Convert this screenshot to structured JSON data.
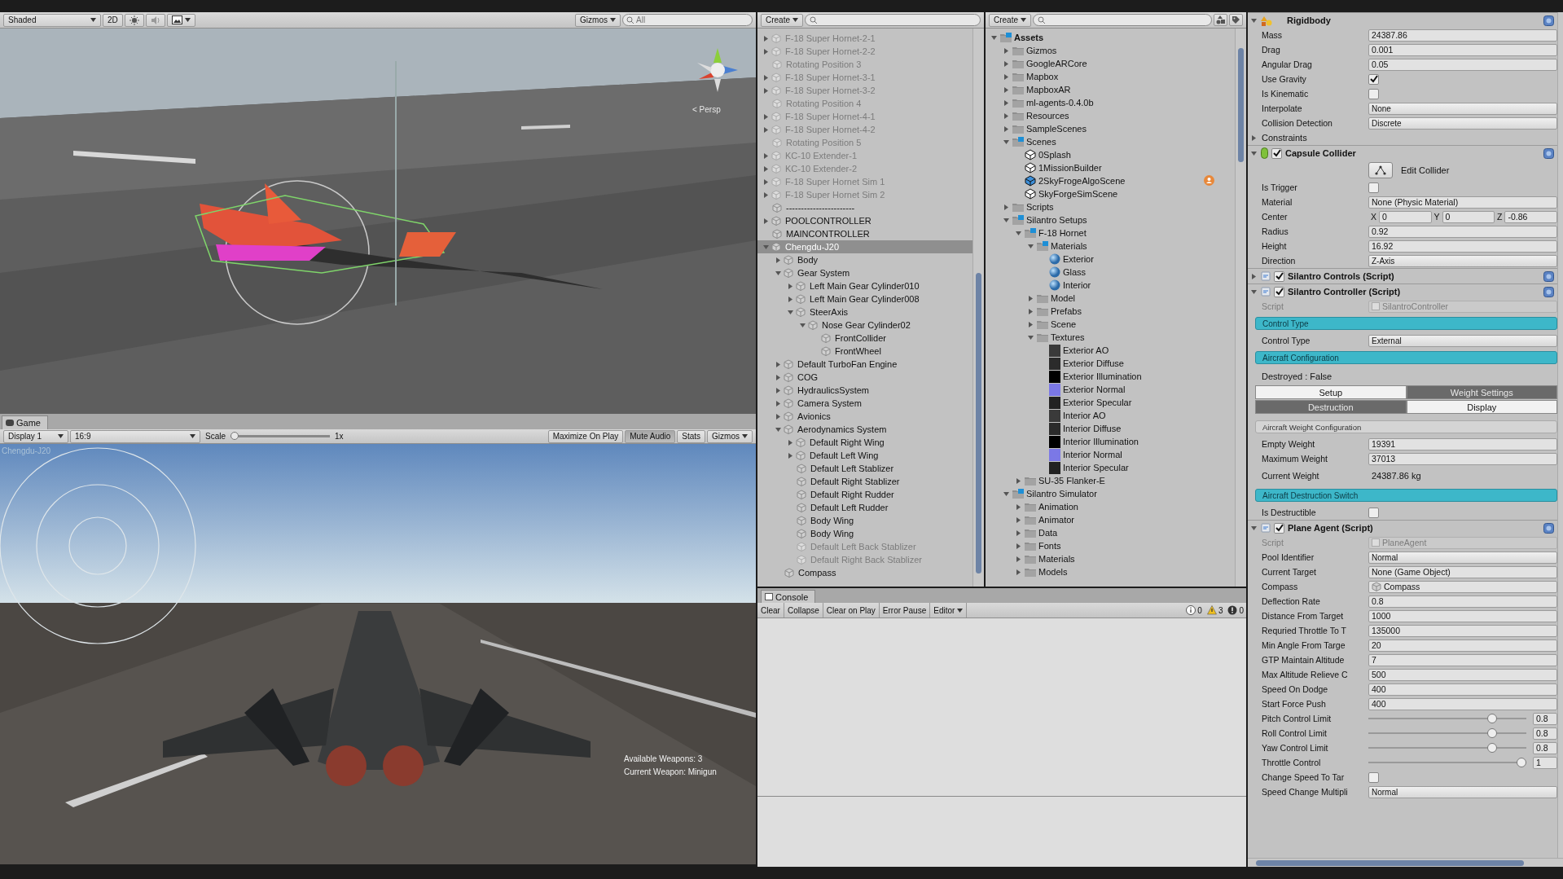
{
  "scene": {
    "toolbar": {
      "shading": "Shaded",
      "mode_2d": "2D",
      "gizmos": "Gizmos",
      "search_placeholder": "All"
    },
    "view": {
      "kind": "picture",
      "projection": "< Persp"
    }
  },
  "game": {
    "tab": "Game",
    "toolbar": {
      "display": "Display 1",
      "aspect": "16:9",
      "scale": {
        "label": "Scale",
        "level": 0,
        "value": "1x"
      },
      "buttons": [
        {
          "label": "Maximize On Play",
          "on": false
        },
        {
          "label": "Mute Audio",
          "on": true
        },
        {
          "label": "Stats",
          "on": false
        }
      ],
      "gizmos": "Gizmos"
    },
    "view": {
      "kind": "picture",
      "object_name": "Chengdu-J20",
      "weapons": "Available Weapons: 3",
      "current_weapon": "Current Weapon: Minigun"
    }
  },
  "hierarchy": {
    "create": "Create",
    "items": [
      {
        "name": "F-18 Super Hornet-2-1",
        "expanded": false,
        "active": false,
        "selected": false
      },
      {
        "name": "F-18 Super Hornet-2-2",
        "expanded": false,
        "active": false,
        "selected": false
      },
      {
        "name": "Rotating Position 3",
        "active": false,
        "selected": false
      },
      {
        "name": "F-18 Super Hornet-3-1",
        "expanded": false,
        "active": false,
        "selected": false
      },
      {
        "name": "F-18 Super Hornet-3-2",
        "expanded": false,
        "active": false,
        "selected": false
      },
      {
        "name": "Rotating Position 4",
        "active": false,
        "selected": false
      },
      {
        "name": "F-18 Super Hornet-4-1",
        "expanded": false,
        "active": false,
        "selected": false
      },
      {
        "name": "F-18 Super Hornet-4-2",
        "expanded": false,
        "active": false,
        "selected": false
      },
      {
        "name": "Rotating Position 5",
        "active": false,
        "selected": false
      },
      {
        "name": "KC-10 Extender-1",
        "expanded": false,
        "active": false,
        "selected": false
      },
      {
        "name": "KC-10 Extender-2",
        "expanded": false,
        "active": false,
        "selected": false
      },
      {
        "name": "F-18 Super Hornet Sim 1",
        "expanded": false,
        "active": false,
        "selected": false
      },
      {
        "name": "F-18 Super Hornet Sim 2",
        "expanded": false,
        "active": false,
        "selected": false
      },
      {
        "name": "-----------------------",
        "active": true,
        "selected": false
      },
      {
        "name": "POOLCONTROLLER",
        "expanded": false,
        "active": true,
        "selected": false
      },
      {
        "name": "MAINCONTROLLER",
        "active": true,
        "selected": false
      },
      {
        "name": "Chengdu-J20",
        "expanded": true,
        "active": true,
        "selected": true,
        "children": [
          {
            "name": "Body",
            "expanded": false,
            "active": true,
            "selected": false
          },
          {
            "name": "Gear System",
            "expanded": true,
            "active": true,
            "selected": false,
            "children": [
              {
                "name": "Left Main Gear Cylinder010",
                "expanded": false,
                "active": true,
                "selected": false
              },
              {
                "name": "Left Main Gear Cylinder008",
                "expanded": false,
                "active": true,
                "selected": false
              },
              {
                "name": "SteerAxis",
                "expanded": true,
                "active": true,
                "selected": false,
                "children": [
                  {
                    "name": "Nose Gear Cylinder02",
                    "expanded": true,
                    "active": true,
                    "selected": false,
                    "children": [
                      {
                        "name": "FrontCollider",
                        "active": true,
                        "selected": false
                      },
                      {
                        "name": "FrontWheel",
                        "active": true,
                        "selected": false
                      }
                    ]
                  }
                ]
              }
            ]
          },
          {
            "name": "Default TurboFan Engine",
            "expanded": false,
            "active": true,
            "selected": false
          },
          {
            "name": "COG",
            "expanded": false,
            "active": true,
            "selected": false
          },
          {
            "name": "HydraulicsSystem",
            "expanded": false,
            "active": true,
            "selected": false
          },
          {
            "name": "Camera System",
            "expanded": false,
            "active": true,
            "selected": false
          },
          {
            "name": "Avionics",
            "expanded": false,
            "active": true,
            "selected": false
          },
          {
            "name": "Aerodynamics System",
            "expanded": true,
            "active": true,
            "selected": false,
            "children": [
              {
                "name": "Default Right Wing",
                "expanded": false,
                "active": true,
                "selected": false
              },
              {
                "name": "Default Left Wing",
                "expanded": false,
                "active": true,
                "selected": false
              },
              {
                "name": "Default Left Stablizer",
                "active": true,
                "selected": false
              },
              {
                "name": "Default Right Stablizer",
                "active": true,
                "selected": false
              },
              {
                "name": "Default Right Rudder",
                "active": true,
                "selected": false
              },
              {
                "name": "Default Left Rudder",
                "active": true,
                "selected": false
              },
              {
                "name": "Body Wing",
                "active": true,
                "selected": false
              },
              {
                "name": "Body Wing",
                "active": true,
                "selected": false
              },
              {
                "name": "Default Left Back Stablizer",
                "active": false,
                "selected": false
              },
              {
                "name": "Default Right Back Stablizer",
                "active": false,
                "selected": false
              }
            ]
          },
          {
            "name": "Compass",
            "active": true,
            "selected": false
          }
        ]
      }
    ]
  },
  "project": {
    "create": "Create",
    "items": [
      {
        "name": "Assets",
        "kind": "blue-folder",
        "expanded": true,
        "children": [
          {
            "name": "Gizmos",
            "kind": "folder",
            "expanded": false
          },
          {
            "name": "GoogleARCore",
            "kind": "folder",
            "expanded": false
          },
          {
            "name": "Mapbox",
            "kind": "folder",
            "expanded": false
          },
          {
            "name": "MapboxAR",
            "kind": "folder",
            "expanded": false
          },
          {
            "name": "ml-agents-0.4.0b",
            "kind": "folder",
            "expanded": false
          },
          {
            "name": "Resources",
            "kind": "folder",
            "expanded": false
          },
          {
            "name": "SampleScenes",
            "kind": "folder",
            "expanded": false
          },
          {
            "name": "Scenes",
            "kind": "blue-folder",
            "expanded": true,
            "children": [
              {
                "name": "0Splash",
                "kind": "scene",
                "shared": false
              },
              {
                "name": "1MissionBuilder",
                "kind": "scene",
                "shared": false
              },
              {
                "name": "2SkyFrogeAlgoScene",
                "kind": "scene",
                "shared": true
              },
              {
                "name": "SkyForgeSimScene",
                "kind": "scene",
                "shared": false
              }
            ]
          },
          {
            "name": "Scripts",
            "kind": "folder",
            "expanded": false
          },
          {
            "name": "Silantro Setups",
            "kind": "blue-folder",
            "expanded": true,
            "children": [
              {
                "name": "F-18 Hornet",
                "kind": "blue-folder",
                "expanded": true,
                "children": [
                  {
                    "name": "Materials",
                    "kind": "blue-folder",
                    "expanded": true,
                    "children": [
                      {
                        "name": "Exterior",
                        "kind": "material"
                      },
                      {
                        "name": "Glass",
                        "kind": "material"
                      },
                      {
                        "name": "Interior",
                        "kind": "material"
                      }
                    ]
                  },
                  {
                    "name": "Model",
                    "kind": "folder",
                    "expanded": false
                  },
                  {
                    "name": "Prefabs",
                    "kind": "folder",
                    "expanded": false
                  },
                  {
                    "name": "Scene",
                    "kind": "folder",
                    "expanded": false
                  },
                  {
                    "name": "Textures",
                    "kind": "folder",
                    "expanded": true,
                    "children": [
                      {
                        "name": "Exterior AO",
                        "kind": "texture",
                        "color": "#3a3a3a"
                      },
                      {
                        "name": "Exterior Diffuse",
                        "kind": "texture",
                        "color": "#2b2b2b"
                      },
                      {
                        "name": "Exterior Illumination",
                        "kind": "texture",
                        "color": "#000000"
                      },
                      {
                        "name": "Exterior Normal",
                        "kind": "texture",
                        "color": "#7b78e6"
                      },
                      {
                        "name": "Exterior Specular",
                        "kind": "texture",
                        "color": "#222222"
                      },
                      {
                        "name": "Interior AO",
                        "kind": "texture",
                        "color": "#3a3a3a"
                      },
                      {
                        "name": "Interior Diffuse",
                        "kind": "texture",
                        "color": "#2b2b2b"
                      },
                      {
                        "name": "Interior Illumination",
                        "kind": "texture",
                        "color": "#000000"
                      },
                      {
                        "name": "Interior Normal",
                        "kind": "texture",
                        "color": "#7b78e6"
                      },
                      {
                        "name": "Interior Specular",
                        "kind": "texture",
                        "color": "#222222"
                      }
                    ]
                  }
                ]
              },
              {
                "name": "SU-35 Flanker-E",
                "kind": "folder",
                "expanded": false
              }
            ]
          },
          {
            "name": "Silantro Simulator",
            "kind": "blue-folder",
            "expanded": true,
            "children": [
              {
                "name": "Animation",
                "kind": "folder",
                "expanded": false
              },
              {
                "name": "Animator",
                "kind": "folder",
                "expanded": false
              },
              {
                "name": "Data",
                "kind": "folder",
                "expanded": false
              },
              {
                "name": "Fonts",
                "kind": "folder",
                "expanded": false
              },
              {
                "name": "Materials",
                "kind": "folder",
                "expanded": false
              },
              {
                "name": "Models",
                "kind": "folder",
                "expanded": false
              }
            ]
          }
        ]
      }
    ]
  },
  "console": {
    "tab": "Console",
    "buttons": [
      "Clear",
      "Collapse",
      "Clear on Play",
      "Error Pause"
    ],
    "editor": "Editor",
    "counts": [
      {
        "kind": "info",
        "count": "0"
      },
      {
        "kind": "warning",
        "count": "3"
      },
      {
        "kind": "error",
        "count": "0"
      }
    ]
  },
  "inspector": {
    "components": [
      {
        "title": "Rigidbody",
        "kind": "rigidbody",
        "expanded": true,
        "rows": [
          {
            "kind": "field",
            "label": "Mass",
            "value": "24387.86"
          },
          {
            "kind": "field",
            "label": "Drag",
            "value": "0.001"
          },
          {
            "kind": "field",
            "label": "Angular Drag",
            "value": "0.05"
          },
          {
            "kind": "checkbox",
            "label": "Use Gravity",
            "checked": true
          },
          {
            "kind": "checkbox",
            "label": "Is Kinematic",
            "checked": false
          },
          {
            "kind": "dropdown",
            "label": "Interpolate",
            "value": "None"
          },
          {
            "kind": "dropdown",
            "label": "Collision Detection",
            "value": "Discrete"
          },
          {
            "kind": "foldout",
            "label": "Constraints",
            "expanded": false
          }
        ]
      },
      {
        "title": "Capsule Collider",
        "kind": "collider",
        "enabled": true,
        "expanded": true,
        "rows": [
          {
            "kind": "edit-button",
            "label": "Edit Collider"
          },
          {
            "kind": "checkbox",
            "label": "Is Trigger",
            "checked": false
          },
          {
            "kind": "object",
            "label": "Material",
            "value": "None (Physic Material)"
          },
          {
            "kind": "vector3",
            "label": "Center",
            "values": [
              {
                "axis": "X",
                "value": "0"
              },
              {
                "axis": "Y",
                "value": "0"
              },
              {
                "axis": "Z",
                "value": "-0.86"
              }
            ]
          },
          {
            "kind": "field",
            "label": "Radius",
            "value": "0.92"
          },
          {
            "kind": "field",
            "label": "Height",
            "value": "16.92"
          },
          {
            "kind": "dropdown",
            "label": "Direction",
            "value": "Z-Axis"
          }
        ]
      },
      {
        "title": "Silantro Controls (Script)",
        "kind": "script",
        "enabled": true,
        "expanded": false
      },
      {
        "title": "Silantro Controller (Script)",
        "kind": "script",
        "enabled": true,
        "expanded": true,
        "rows": [
          {
            "kind": "script",
            "label": "Script",
            "value": "SilantroController"
          },
          {
            "kind": "header",
            "text": "Control Type"
          },
          {
            "kind": "dropdown",
            "label": "Control Type",
            "value": "External"
          },
          {
            "kind": "header",
            "text": "Aircraft Configuration"
          },
          {
            "kind": "text",
            "text": "Destroyed : False"
          },
          {
            "kind": "toolbar",
            "buttons": [
              {
                "label": "Setup",
                "selected": false
              },
              {
                "label": "Weight Settings",
                "selected": true
              }
            ]
          },
          {
            "kind": "toolbar",
            "buttons": [
              {
                "label": "Destruction",
                "selected": true
              },
              {
                "label": "Display",
                "selected": false
              }
            ]
          },
          {
            "kind": "subheader",
            "text": "Aircraft Weight Configuration"
          },
          {
            "kind": "field",
            "label": "Empty Weight",
            "value": "19391"
          },
          {
            "kind": "field",
            "label": "Maximum Weight",
            "value": "37013"
          },
          {
            "kind": "label-value",
            "label": "Current Weight",
            "value": "24387.86 kg"
          },
          {
            "kind": "header",
            "text": "Aircraft Destruction Switch"
          },
          {
            "kind": "checkbox",
            "label": "Is Destructible",
            "checked": false
          }
        ]
      },
      {
        "title": "Plane Agent (Script)",
        "kind": "script",
        "enabled": true,
        "expanded": true,
        "rows": [
          {
            "kind": "script",
            "label": "Script",
            "value": "PlaneAgent"
          },
          {
            "kind": "dropdown",
            "label": "Pool Identifier",
            "value": "Normal"
          },
          {
            "kind": "object",
            "label": "Current Target",
            "value": "None (Game Object)"
          },
          {
            "kind": "object",
            "label": "Compass",
            "value": "Compass",
            "has_icon": true
          },
          {
            "kind": "field",
            "label": "Deflection Rate",
            "value": "0.8"
          },
          {
            "kind": "field",
            "label": "Distance From Target",
            "value": "1000"
          },
          {
            "kind": "field",
            "label": "Requried Throttle To T",
            "value": "135000"
          },
          {
            "kind": "field",
            "label": "Min Angle From Targe",
            "value": "20"
          },
          {
            "kind": "field",
            "label": "GTP Maintain Altitude",
            "value": "7"
          },
          {
            "kind": "field",
            "label": "Max Altitude Relieve C",
            "value": "500"
          },
          {
            "kind": "field",
            "label": "Speed On Dodge",
            "value": "400"
          },
          {
            "kind": "field",
            "label": "Start Force Push",
            "value": "400"
          },
          {
            "kind": "slider",
            "label": "Pitch Control Limit",
            "level": 0.8,
            "value": "0.8"
          },
          {
            "kind": "slider",
            "label": "Roll Control Limit",
            "level": 0.8,
            "value": "0.8"
          },
          {
            "kind": "slider",
            "label": "Yaw Control Limit",
            "level": 0.8,
            "value": "0.8"
          },
          {
            "kind": "slider",
            "label": "Throttle Control",
            "level": 1,
            "value": "1"
          },
          {
            "kind": "checkbox",
            "label": "Change Speed To Tar",
            "checked": false
          },
          {
            "kind": "dropdown",
            "label": "Speed Change Multipli",
            "value": "Normal"
          }
        ]
      }
    ]
  }
}
